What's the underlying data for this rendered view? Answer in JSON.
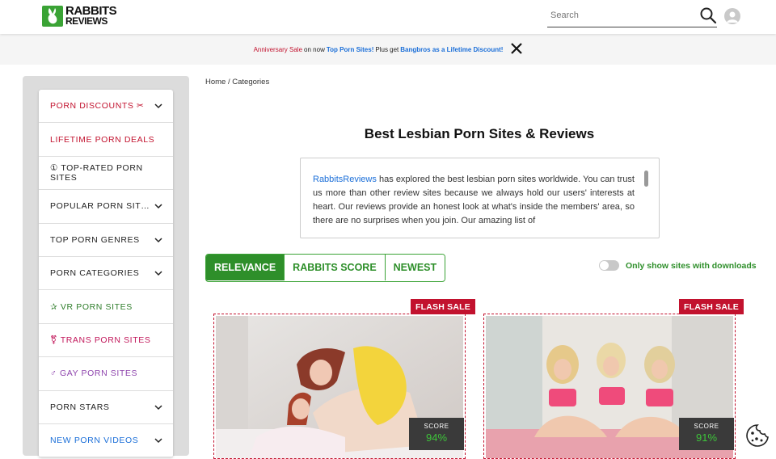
{
  "header": {
    "logo_line1": "RABBITS",
    "logo_line2": "REVIEWS",
    "search_placeholder": "Search"
  },
  "promo": {
    "part1": "Anniversary Sale",
    "part2": "on now",
    "part3": "Top Porn Sites!",
    "part4": "Plus get",
    "part5": "Bangbros as a Lifetime Discount!"
  },
  "sidebar": {
    "items": [
      {
        "label": "PORN DISCOUNTS ✂",
        "color": "#c2122e",
        "chevron": true
      },
      {
        "label": "LIFETIME PORN DEALS",
        "color": "#c2122e",
        "chevron": false
      },
      {
        "label": "① TOP-RATED PORN SITES",
        "color": "#222222",
        "chevron": false
      },
      {
        "label": "POPULAR PORN SIT…",
        "color": "#222222",
        "chevron": true
      },
      {
        "label": "TOP PORN GENRES",
        "color": "#222222",
        "chevron": true
      },
      {
        "label": "PORN CATEGORIES",
        "color": "#222222",
        "chevron": true
      },
      {
        "label": "✰ VR PORN SITES",
        "color": "#2e7d2a",
        "chevron": false
      },
      {
        "label": "⚧ TRANS PORN SITES",
        "color": "#c2185b",
        "chevron": false
      },
      {
        "label": "♂ GAY PORN SITES",
        "color": "#8e44ad",
        "chevron": false
      },
      {
        "label": "PORN STARS",
        "color": "#222222",
        "chevron": true
      },
      {
        "label": "NEW PORN VIDEOS",
        "color": "#1a6ed8",
        "chevron": true
      }
    ]
  },
  "breadcrumb": "Home / Categories",
  "main": {
    "title": "Best Lesbian Porn Sites & Reviews",
    "intro_link": "RabbitsReviews",
    "intro_text": " has explored the best lesbian porn sites worldwide. You can trust us more than other review sites because we always hold our users' interests at heart. Our reviews provide an honest look at what's inside the members' area, so there are no surprises when you join. Our amazing list of"
  },
  "sort": {
    "relevance": "RELEVANCE",
    "score": "RABBITS SCORE",
    "newest": "NEWEST"
  },
  "toggle_label": "Only show sites with downloads",
  "cards": [
    {
      "flash": "FLASH SALE",
      "score_label": "SCORE",
      "score": "94%"
    },
    {
      "flash": "FLASH SALE",
      "score_label": "SCORE",
      "score": "91%"
    }
  ],
  "colors": {
    "brand_green": "#3aa335",
    "accent_red": "#c2122e",
    "link_blue": "#1a6ed8"
  }
}
